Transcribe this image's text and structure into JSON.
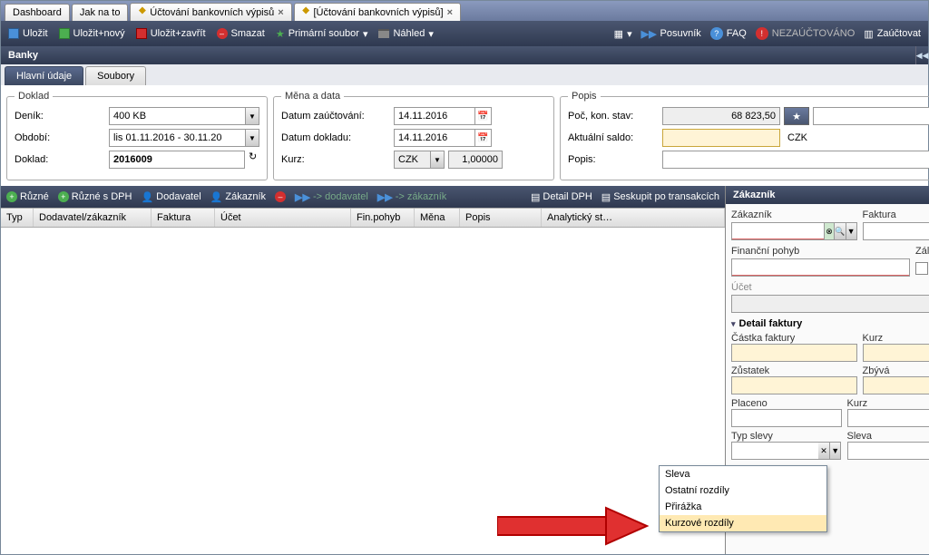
{
  "tabs": [
    "Dashboard",
    "Jak na to",
    "Účtování bankovních výpisů",
    "[Účtování bankovních výpisů]"
  ],
  "toolbar": {
    "save": "Uložit",
    "saveNew": "Uložit+nový",
    "saveClose": "Uložit+zavřít",
    "delete": "Smazat",
    "primary": "Primární soubor",
    "preview": "Náhled",
    "posuvnik": "Posuvník",
    "faq": "FAQ",
    "nezau": "NEZAÚČTOVÁNO",
    "zau": "Zaúčtovat"
  },
  "title": "Banky",
  "subtabs": {
    "main": "Hlavní údaje",
    "files": "Soubory"
  },
  "doklad": {
    "legend": "Doklad",
    "denik": "Deník:",
    "denikVal": "400 KB",
    "obdobi": "Období:",
    "obdobiVal": "lis 01.11.2016 - 30.11.20",
    "doklad": "Doklad:",
    "dokladVal": "2016009"
  },
  "mena": {
    "legend": "Měna a data",
    "dzau": "Datum zaúčtování:",
    "dzauVal": "14.11.2016",
    "ddok": "Datum dokladu:",
    "ddokVal": "14.11.2016",
    "kurz": "Kurz:",
    "kurzCur": "CZK",
    "kurzVal": "1,00000"
  },
  "popis": {
    "legend": "Popis",
    "poc": "Poč, kon. stav:",
    "pocVal": "68 823,50",
    "saldo": "Aktuální saldo:",
    "saldoCur": "CZK",
    "popis": "Popis:"
  },
  "gridtb": {
    "ruzne": "Různé",
    "ruzneDPH": "Různé s DPH",
    "dodavatel": "Dodavatel",
    "zakaznik": "Zákazník",
    "toDod": "-> dodavatel",
    "toZak": "-> zákazník",
    "detail": "Detail DPH",
    "seskupit": "Seskupit po transakcích"
  },
  "cols": {
    "typ": "Typ",
    "dz": "Dodavatel/zákazník",
    "fa": "Faktura",
    "ucet": "Účet",
    "fp": "Fin.pohyb",
    "mena": "Měna",
    "popis": "Popis",
    "ast": "Analytický st…"
  },
  "side": {
    "title": "Zákazník",
    "zakaznik": "Zákazník",
    "faktura": "Faktura",
    "finp": "Finanční pohyb",
    "zaloha": "Záloha",
    "ucet": "Účet",
    "detail": "Detail faktury",
    "castka": "Částka faktury",
    "kurz": "Kurz",
    "zustatek": "Zůstatek",
    "zbyva": "Zbývá",
    "placeno": "Placeno",
    "typSlevy": "Typ slevy",
    "sleva": "Sleva"
  },
  "dd": {
    "o1": "Sleva",
    "o2": "Ostatní rozdíly",
    "o3": "Přirážka",
    "o4": "Kurzové rozdíly"
  }
}
